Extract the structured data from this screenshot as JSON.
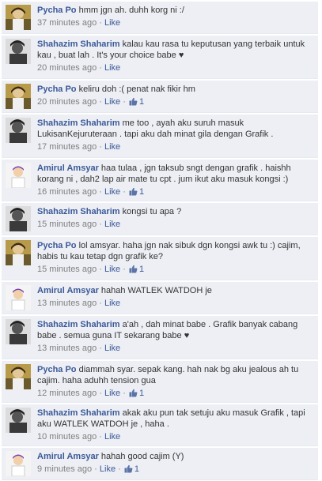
{
  "comments": [
    {
      "author": "Pycha Po",
      "avatar": "pycha-avatar",
      "text": "hmm jgn ah. duhh korg ni :/",
      "time": "37 minutes ago",
      "like_label": "Like",
      "likes": ""
    },
    {
      "author": "Shahazim Shaharim",
      "avatar": "shahazim-avatar",
      "text": "kalau kau rasa tu keputusan yang terbaik untuk kau , buat lah . It's your choice babe ♥",
      "time": "20 minutes ago",
      "like_label": "Like",
      "likes": ""
    },
    {
      "author": "Pycha Po",
      "avatar": "pycha-avatar",
      "text": "keliru doh :( penat nak fikir hm",
      "time": "20 minutes ago",
      "like_label": "Like",
      "likes": "1"
    },
    {
      "author": "Shahazim Shaharim",
      "avatar": "shahazim-avatar",
      "text": "me too , ayah aku suruh masuk LukisanKejuruteraan . tapi aku dah minat gila dengan Grafik .",
      "time": "17 minutes ago",
      "like_label": "Like",
      "likes": ""
    },
    {
      "author": "Amirul Amsyar",
      "avatar": "amirul-avatar",
      "text": "haa tulaa , jgn taksub sngt dengan grafik . haishh korang ni , dah2 lap air mate tu cpt . jum ikut aku masuk kongsi :)",
      "time": "16 minutes ago",
      "like_label": "Like",
      "likes": "1"
    },
    {
      "author": "Shahazim Shaharim",
      "avatar": "shahazim-avatar",
      "text": "kongsi tu apa ?",
      "time": "15 minutes ago",
      "like_label": "Like",
      "likes": ""
    },
    {
      "author": "Pycha Po",
      "avatar": "pycha-avatar",
      "text": "lol amsyar. haha jgn nak sibuk dgn kongsi awk tu :) cajim, habis tu kau tetap dgn grafik ke?",
      "time": "15 minutes ago",
      "like_label": "Like",
      "likes": "1"
    },
    {
      "author": "Amirul Amsyar",
      "avatar": "amirul-avatar",
      "text": "hahah WATLEK WATDOH je",
      "time": "13 minutes ago",
      "like_label": "Like",
      "likes": ""
    },
    {
      "author": "Shahazim Shaharim",
      "avatar": "shahazim-avatar",
      "text": "a'ah , dah minat babe . Grafik banyak cabang babe . semua guna IT sekarang babe ♥",
      "time": "13 minutes ago",
      "like_label": "Like",
      "likes": ""
    },
    {
      "author": "Pycha Po",
      "avatar": "pycha-avatar",
      "text": "diammah syar. sepak kang. hah nak bg aku jealous ah tu cajim. haha aduhh tension gua",
      "time": "12 minutes ago",
      "like_label": "Like",
      "likes": "1"
    },
    {
      "author": "Shahazim Shaharim",
      "avatar": "shahazim-avatar",
      "text": "akak aku pun tak setuju aku masuk Grafik , tapi aku WATLEK WATDOH je , haha .",
      "time": "10 minutes ago",
      "like_label": "Like",
      "likes": ""
    },
    {
      "author": "Amirul Amsyar",
      "avatar": "amirul-avatar",
      "text": "hahah good cajim (Y)",
      "time": "9 minutes ago",
      "like_label": "Like",
      "likes": "1"
    }
  ]
}
